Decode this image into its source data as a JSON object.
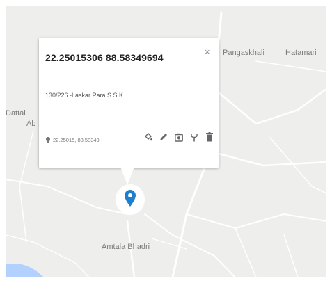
{
  "map": {
    "background_color": "#eeeeec",
    "road_color": "#ffffff",
    "places": [
      {
        "id": "pangaskhali",
        "label": "Pangaskhali"
      },
      {
        "id": "hatamari",
        "label": "Hatamari"
      },
      {
        "id": "amtala",
        "label": "Amtala Bhadri"
      },
      {
        "id": "dattal",
        "label": "Dattal"
      },
      {
        "id": "ab",
        "label": "Ab"
      }
    ]
  },
  "popup": {
    "title": "22.25015306 88.58349694",
    "close_label": "×",
    "address": "130/226 -Laskar Para S.S.K",
    "coordinates": "22.25015, 88.58349",
    "tools": [
      {
        "icon": "paint-bucket-icon"
      },
      {
        "icon": "pencil-icon"
      },
      {
        "icon": "camera-icon"
      },
      {
        "icon": "fork-icon"
      },
      {
        "icon": "trash-icon"
      }
    ]
  },
  "marker": {
    "icon": "map-pin-icon",
    "color": "#1e7fcf"
  }
}
